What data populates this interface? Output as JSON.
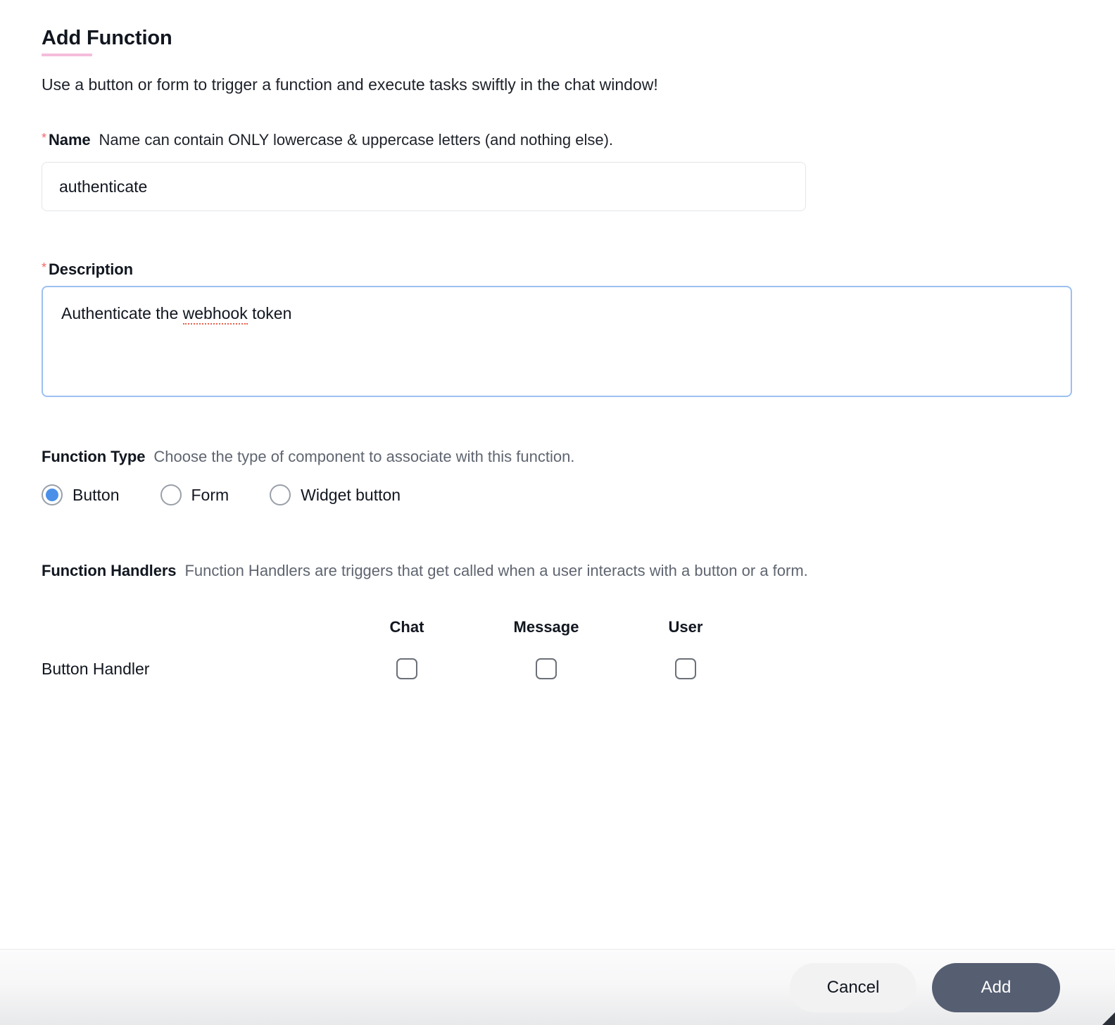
{
  "header": {
    "title": "Add Function",
    "accent_color": "#f5bddc",
    "subtitle": "Use a button or form to trigger a function and execute tasks swiftly in the chat window!"
  },
  "fields": {
    "name": {
      "required_marker": "*",
      "label": "Name",
      "hint": "Name can contain ONLY lowercase & uppercase letters (and nothing else).",
      "value": "authenticate",
      "placeholder": "Name"
    },
    "description": {
      "required_marker": "*",
      "label": "Description",
      "value_before_error": "Authenticate the ",
      "value_error_word": "webhook",
      "value_after_error": " token",
      "value": "Authenticate the webhook token",
      "placeholder": "Description",
      "focused": true,
      "focus_border_color": "#9cc0f0",
      "spellcheck_underline_color": "#e8604c"
    }
  },
  "function_type": {
    "label": "Function Type",
    "hint": "Choose the type of component to associate with this function.",
    "selected": "Button",
    "selected_color": "#4a90e8",
    "options": [
      {
        "label": "Button",
        "selected": true
      },
      {
        "label": "Form",
        "selected": false
      },
      {
        "label": "Widget button",
        "selected": false
      }
    ]
  },
  "function_handlers": {
    "label": "Function Handlers",
    "hint": "Function Handlers are triggers that get called when a user interacts with a button or a form.",
    "columns": [
      "Chat",
      "Message",
      "User"
    ],
    "rows": [
      {
        "name": "Button Handler",
        "checks": [
          false,
          false,
          false
        ]
      }
    ]
  },
  "footer": {
    "cancel_label": "Cancel",
    "add_label": "Add",
    "add_color": "#565e72",
    "cancel_color": "#f2f2f3"
  },
  "required_star_color": "#f2696e"
}
